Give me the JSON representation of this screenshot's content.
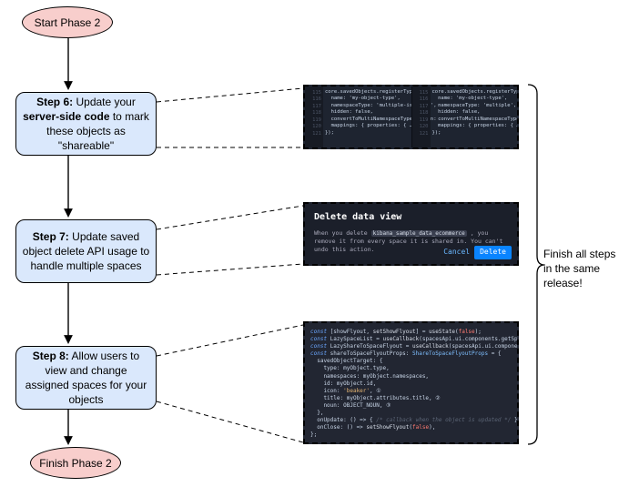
{
  "start": {
    "label": "Start Phase 2"
  },
  "finish": {
    "label": "Finish Phase 2"
  },
  "steps": {
    "s6": {
      "prefix": "Step 6:",
      "rest": " Update your ",
      "strong": "server-side code",
      "rest2": " to mark these objects as \"shareable\""
    },
    "s7": {
      "prefix": "Step 7:",
      "rest": " Update saved object delete API usage to handle multiple spaces"
    },
    "s8": {
      "prefix": "Step 8:",
      "rest": " Allow users to view and change assigned spaces for your objects"
    }
  },
  "annotation": {
    "line1": "Finish all steps",
    "line2": "in the same",
    "line3": "release!"
  },
  "ss1": {
    "lines_left": [
      "core.savedObjects.registerType({",
      "  name: 'my-object-type',",
      "  namespaceType: 'multiple-isolated',",
      "  hidden: false,",
      "  convertToMultiNamespaceTypeVersion:",
      "  mappings: { properties: { … } },",
      "});"
    ],
    "lines_right": [
      "core.savedObjects.registerType({",
      "  name: 'my-object-type',",
      "  namespaceType: 'multiple',",
      "  hidden: false,",
      "  convertToMultiNamespaceTypeVersion:",
      "  mappings: { properties: { … } },",
      "});"
    ],
    "gutter_left": [
      "115",
      "116",
      "117",
      "118",
      "119",
      "120",
      "121"
    ],
    "gutter_right": [
      "115",
      "116",
      "117",
      "118",
      "119",
      "120",
      "121"
    ]
  },
  "ss2": {
    "title": "Delete data view",
    "body_pre": "When you delete ",
    "token": "kibana_sample_data_ecommerce",
    "body_post": " , you remove it from every space it is shared in. You can't undo this action.",
    "cancel": "Cancel",
    "delete": "Delete"
  },
  "ss3": {
    "lines": [
      "const [showFlyout, setShowFlyout] = useState(false);",
      "const LazySpaceList = useCallback(spacesApi.ui.components.getSpaceLi",
      "const LazyShareToSpaceFlyout = useCallback(spacesApi.ui.components.ge",
      "",
      "const shareToSpaceFlyoutProps: ShareToSpaceFlyoutProps = {",
      "  savedObjectTarget: {",
      "    type: myObject.type,",
      "    namespaces: myObject.namespaces,",
      "    id: myObject.id,",
      "    icon: 'beaker', ①",
      "    title: myObject.attributes.title, ②",
      "    noun: OBJECT_NOUN, ③",
      "  },",
      "  onUpdate: () => { /* callback when the object is updated */ },",
      "  onClose: () => setShowFlyout(false),",
      "};"
    ]
  }
}
